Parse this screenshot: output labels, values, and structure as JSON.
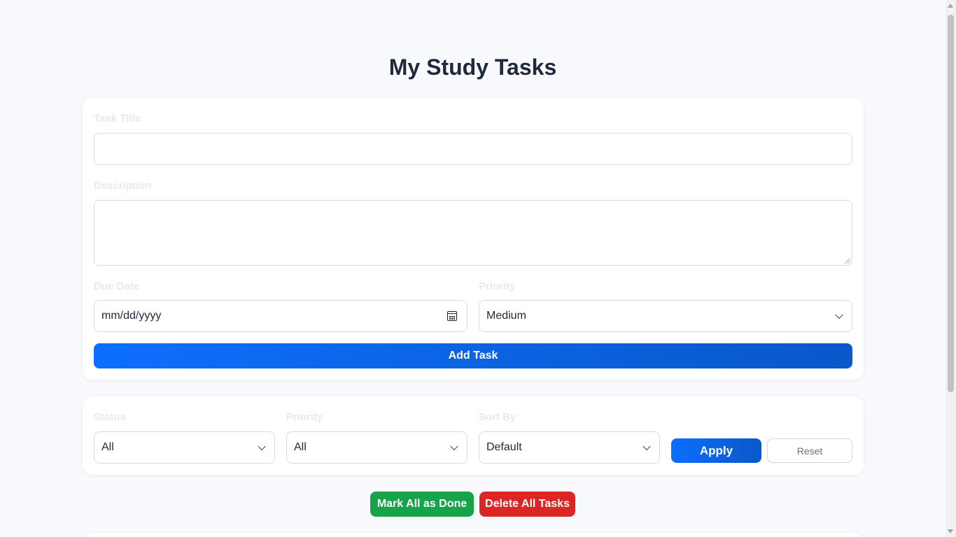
{
  "page": {
    "title": "My Study Tasks"
  },
  "form": {
    "title_label": "Task Title",
    "title_value": "",
    "description_label": "Description",
    "description_value": "",
    "due_date_label": "Due Date",
    "due_date_placeholder": "mm/dd/yyyy",
    "priority_label": "Priority",
    "priority_value": "Medium",
    "add_button": "Add Task"
  },
  "filters": {
    "status_label": "Status",
    "status_value": "All",
    "priority_label": "Priority",
    "priority_value": "All",
    "sort_label": "Sort By",
    "sort_value": "Default",
    "apply_button": "Apply",
    "reset_button": "Reset"
  },
  "bulk": {
    "mark_done_button": "Mark All as Done",
    "delete_all_button": "Delete All Tasks"
  },
  "colors": {
    "primary": "#0d6efd",
    "success": "#16a34a",
    "danger": "#dc2626",
    "background": "#f7f9fc"
  }
}
